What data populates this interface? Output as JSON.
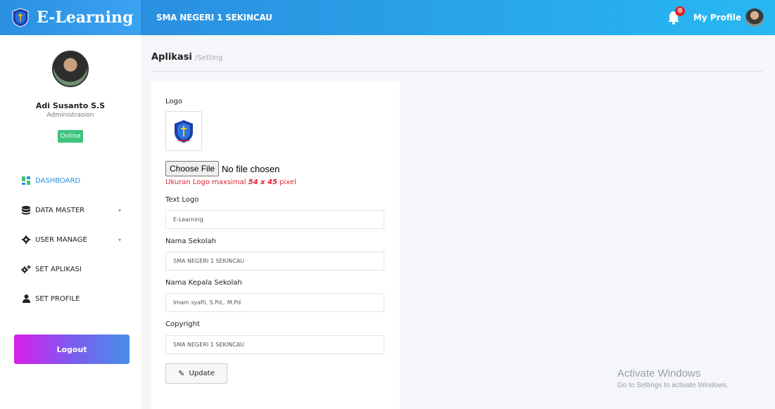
{
  "brand": {
    "title": "E-Learning",
    "logo_icon": "school-crest-icon"
  },
  "navbar": {
    "school_name": "SMA NEGERI 1 SEKINCAU",
    "notification_count": "0",
    "profile_label": "My Profile"
  },
  "sidebar": {
    "user_name": "Adi Susanto S.S",
    "user_role": "Administrasion",
    "status": "Online",
    "items": [
      {
        "label": "DASHBOARD",
        "icon": "dashboard-icon"
      },
      {
        "label": "DATA MASTER",
        "icon": "database-icon"
      },
      {
        "label": "USER MANAGE",
        "icon": "gear-icon"
      },
      {
        "label": "SET APLIKASI",
        "icon": "cogs-icon"
      },
      {
        "label": "SET PROFILE",
        "icon": "user-icon"
      }
    ],
    "logout_label": "Logout"
  },
  "breadcrumb": {
    "main": "Aplikasi",
    "sub": "/Setting"
  },
  "form": {
    "logo_label": "Logo",
    "file_button": "Choose File",
    "file_status": "No file chosen",
    "hint_prefix": "Ukuran Logo maxsimal ",
    "hint_size": "54 x 45",
    "hint_suffix": " pixel",
    "text_logo_label": "Text Logo",
    "text_logo_value": "E-Learning",
    "school_label": "Nama Sekolah",
    "school_value": "SMA NEGERI 1 SEKINCAU",
    "principal_label": "Nama Kepala Sekolah",
    "principal_value": "Imam syafii, S.Pd,. M.Pd",
    "copyright_label": "Copyright",
    "copyright_value": "SMA NEGERI 1 SEKINCAU",
    "update_label": "Update"
  },
  "watermark": {
    "line1": "Activate Windows",
    "line2": "Go to Settings to activate Windows."
  },
  "colors": {
    "accent": "#2a8fe0",
    "online": "#3cc47c",
    "hint": "#e0242f"
  }
}
